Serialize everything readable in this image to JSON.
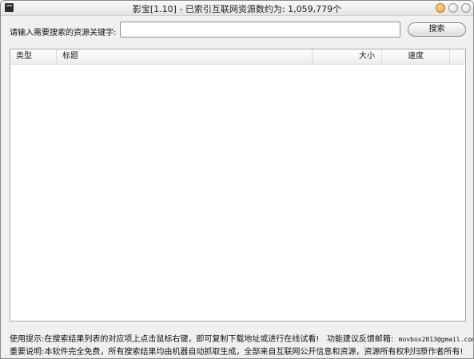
{
  "window": {
    "title": "影宝[1.10] - 已索引互联网资源数约为: 1,059,779个",
    "buttons": [
      "minimize",
      "maximize",
      "close"
    ]
  },
  "search": {
    "label": "请输入需要搜索的资源关键字:",
    "value": "",
    "button_label": "搜索"
  },
  "results_table": {
    "columns": [
      "类型",
      "标题",
      "大小",
      "速度"
    ],
    "rows": []
  },
  "footer": {
    "tip_label": "使用提示:",
    "tip_text": "在搜索结果列表的对应项上点击鼠标右键，即可复制下载地址或进行在线试看!",
    "feedback_label": "功能建议反馈邮箱:",
    "feedback_email": "movbox2013@gmail.com",
    "notice_label": "重要说明:",
    "notice_text": "本软件完全免费，所有搜索结果均由机器自动抓取生成，全部来自互联网公开信息和资源，资源所有权利归原作者所有!"
  }
}
